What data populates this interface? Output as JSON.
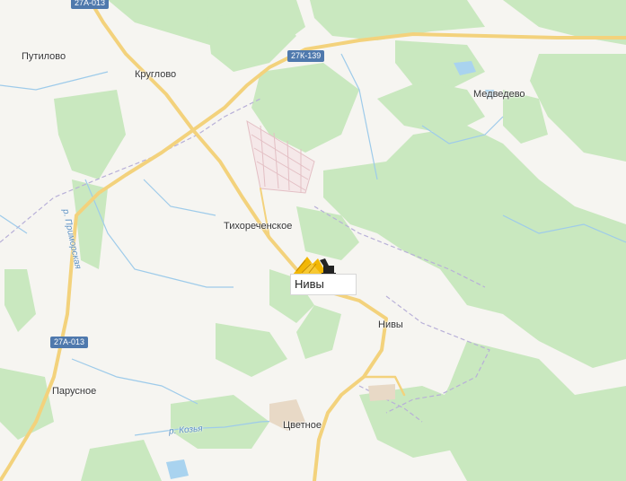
{
  "map": {
    "places": {
      "putilovo": "Путилово",
      "kruglovo": "Круглово",
      "medvedevo": "Медведево",
      "tikhorechenskoe": "Тихореченское",
      "nivy_village": "Нивы",
      "parusnoe": "Парусное",
      "tsvetnoe": "Цветное"
    },
    "roads": {
      "road_27a013_top": "27А-013",
      "road_27k139": "27К-139",
      "road_27a013_left": "27А-013"
    },
    "rivers": {
      "primorskaya": "р. Приморская",
      "kozya": "р. Козья"
    },
    "marker": {
      "label": "Нивы",
      "icon": "quarry-excavator-icon",
      "color": "#f2b705"
    },
    "colors": {
      "background": "#f6f5f1",
      "forest": "#c9e8bf",
      "road": "#f3d27c",
      "road_badge": "#4f79ad",
      "water": "#a9d3ef",
      "boundary": "#b8b0d8"
    }
  }
}
